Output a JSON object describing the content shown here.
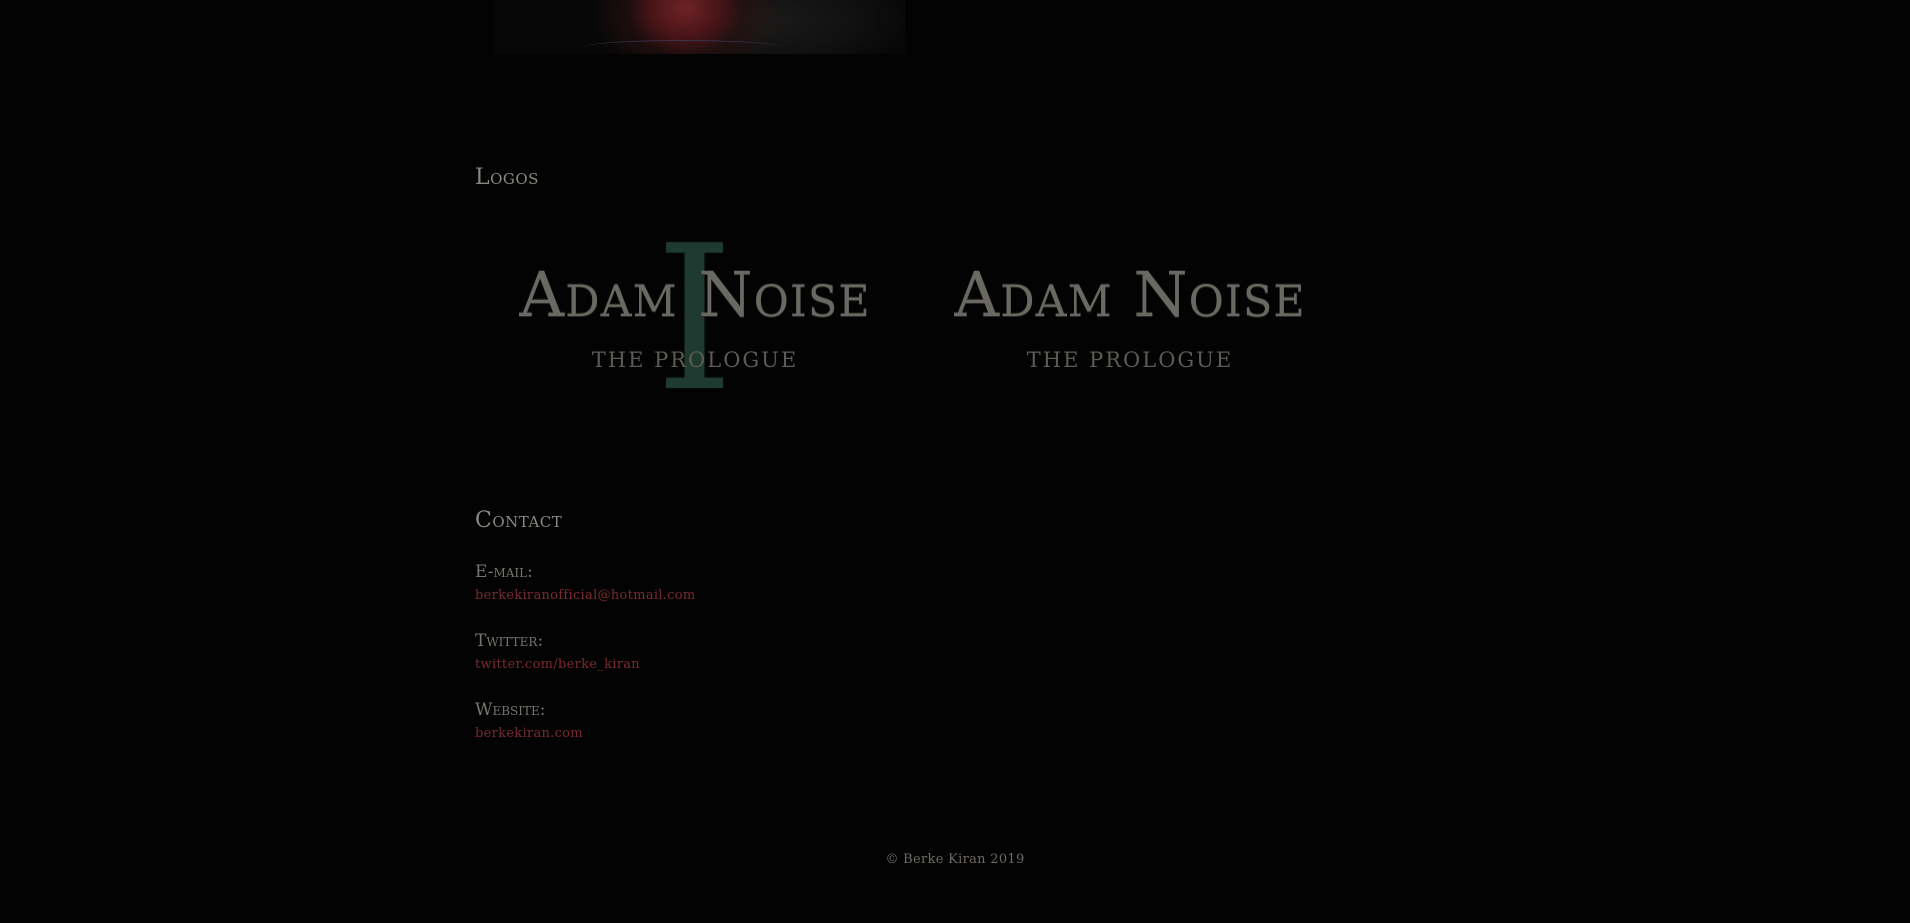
{
  "hero": {
    "image_name": "portrait-image"
  },
  "logos_section": {
    "title": "Logos",
    "logos": [
      {
        "numeral": "I",
        "name": "Adam Noise",
        "subtitle": "THE PROLOGUE"
      },
      {
        "numeral": "",
        "name": "Adam Noise",
        "subtitle": "THE PROLOGUE"
      }
    ]
  },
  "contact_section": {
    "title": "Contact",
    "email_label": "E-mail:",
    "email_value": "berkekiranofficial@hotmail.com",
    "twitter_label": "Twitter:",
    "twitter_value": "twitter.com/berke_kiran",
    "website_label": "Website:",
    "website_value": "berkekiran.com"
  },
  "footer": {
    "copyright": "© Berke Kiran 2019"
  },
  "colors": {
    "background": "#030303",
    "text": "#8a8780",
    "link": "#7a2a30",
    "numeral": "#1f3a30"
  }
}
